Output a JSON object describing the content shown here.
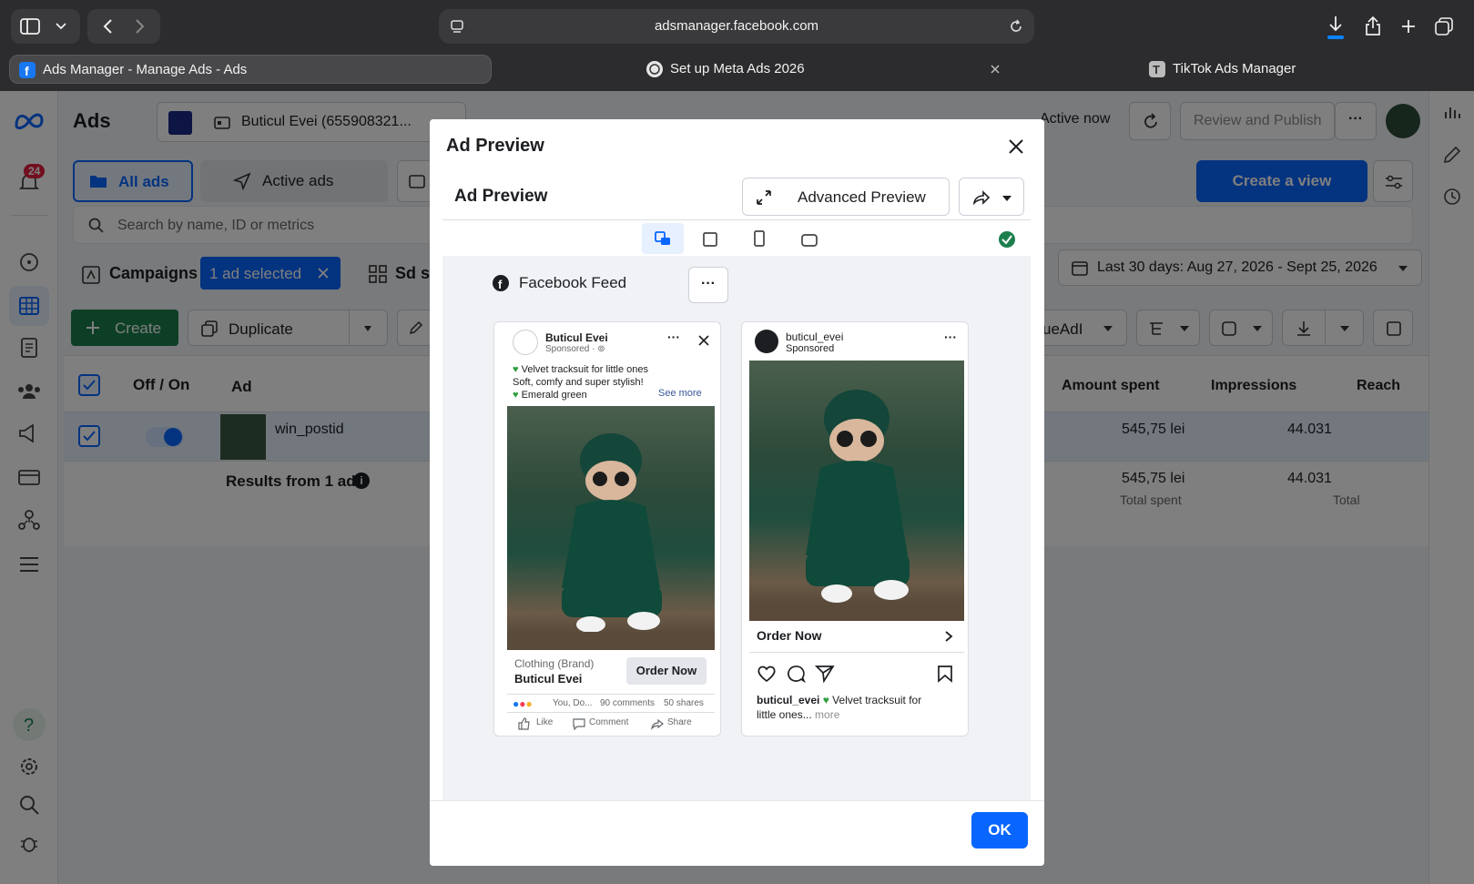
{
  "browser": {
    "url": "adsmanager.facebook.com",
    "tabs": [
      {
        "label": "Ads Manager - Manage Ads - Ads",
        "active": true
      },
      {
        "label": "Set up Meta Ads 2026",
        "active": false
      },
      {
        "label": "TikTok Ads Manager",
        "active": false
      }
    ]
  },
  "app": {
    "title": "Ads",
    "account": "Buticul Evei (655908321...",
    "notifications": "24",
    "status": "Active now",
    "review_publish": "Review and Publish",
    "tabs": {
      "all_ads": "All ads",
      "active_ads": "Active ads"
    },
    "create_view": "Create a view",
    "search_placeholder": "Search by name, ID or metrics",
    "campaigns": "Campaigns",
    "selected": "1 ad selected",
    "sets_partial": "Sd se",
    "date_range": "Last 30 days: Aug 27, 2026 - Sept 25, 2026",
    "create": "Create",
    "duplicate": "Duplicate",
    "column_partial": "ueAdI",
    "table": {
      "headers": {
        "off_on": "Off / On",
        "ad": "Ad",
        "amount": "Amount spent",
        "impressions": "Impressions",
        "reach": "Reach"
      },
      "row": {
        "name": "win_postid",
        "amount": "545,75 lei",
        "impressions": "44.031"
      },
      "results": {
        "label": "Results from 1 ad",
        "amount": "545,75 lei",
        "amount_sub": "Total spent",
        "impressions": "44.031",
        "impressions_sub": "Total"
      }
    }
  },
  "modal": {
    "title": "Ad Preview",
    "subtitle": "Ad Preview",
    "advanced_preview": "Advanced Preview",
    "placement": "Facebook Feed",
    "ok": "OK",
    "fb_post": {
      "page_name": "Buticul Evei",
      "sponsored": "Sponsored · ",
      "line1": "Velvet tracksuit for little ones",
      "line2": "Soft, comfy and super stylish!",
      "line3": "Emerald green",
      "see_more": "See more",
      "category": "Clothing (Brand)",
      "brand": "Buticul Evei",
      "cta": "Order Now",
      "reactions": "You, Do...",
      "comments": "90 comments",
      "shares": "50 shares",
      "like": "Like",
      "comment": "Comment",
      "share": "Share"
    },
    "ig_post": {
      "username": "buticul_evei",
      "sponsored": "Sponsored",
      "cta": "Order Now",
      "caption_user": "buticul_evei",
      "caption_text": "Velvet tracksuit for",
      "caption_line2": "little ones...",
      "more": "more"
    }
  },
  "colors": {
    "accent": "#0866ff",
    "create_green": "#1b7f4d",
    "selected_blue": "#0866ff",
    "badge_red": "#e41e3f"
  }
}
